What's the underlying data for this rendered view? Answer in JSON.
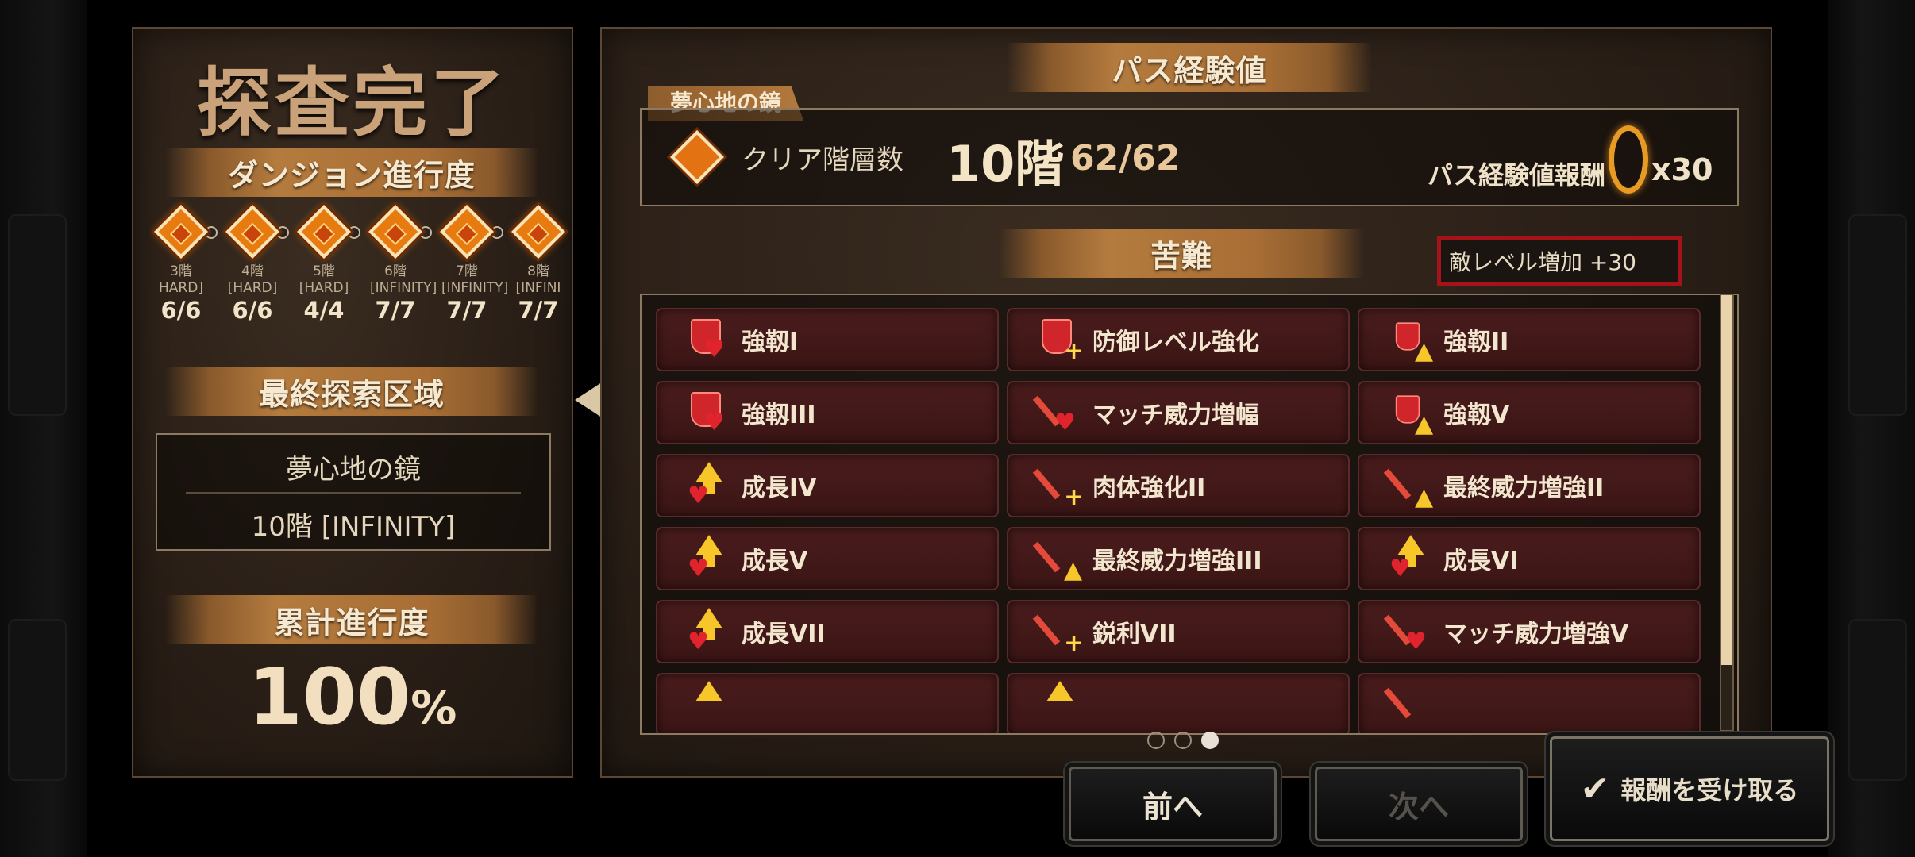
{
  "title": "探査完了",
  "dungeon_progress": {
    "heading": "ダンジョン進行度",
    "floors": [
      {
        "floor": "3階",
        "mode": "HARD]",
        "count": "6/6"
      },
      {
        "floor": "4階",
        "mode": "[HARD]",
        "count": "6/6"
      },
      {
        "floor": "5階",
        "mode": "[HARD]",
        "count": "4/4"
      },
      {
        "floor": "6階",
        "mode": "[INFINITY]",
        "count": "7/7"
      },
      {
        "floor": "7階",
        "mode": "[INFINITY]",
        "count": "7/7"
      },
      {
        "floor": "8階",
        "mode": "[INFINI",
        "count": "7/7"
      }
    ]
  },
  "final_area": {
    "heading": "最終探索区域",
    "name": "夢心地の鏡",
    "floor": "10階 [INFINITY]"
  },
  "total_progress": {
    "heading": "累計進行度",
    "value": "100",
    "unit": "%"
  },
  "pass_exp": {
    "heading": "パス経験値",
    "tag": "夢心地の鏡",
    "clear_label": "クリア階層数",
    "clear_floor": "10階",
    "clear_count": "62/62",
    "reward_label": "パス経験値報酬",
    "reward_mult": "x30"
  },
  "hardship": {
    "heading": "苦難",
    "enemy_level": "敵レベル増加 +30",
    "items": [
      {
        "label": "強靱I",
        "icon": "shield-heart-icon"
      },
      {
        "label": "防御レベル強化",
        "icon": "shield-plus-icon"
      },
      {
        "label": "強靱II",
        "icon": "shield-up-icon"
      },
      {
        "label": "強靱III",
        "icon": "shield-heart-icon"
      },
      {
        "label": "マッチ威力増幅",
        "icon": "sword-heart-icon"
      },
      {
        "label": "強靱V",
        "icon": "shield-up-icon"
      },
      {
        "label": "成長IV",
        "icon": "up-heart-icon"
      },
      {
        "label": "肉体強化II",
        "icon": "sword-plus-icon"
      },
      {
        "label": "最終威力増強II",
        "icon": "sword-up-icon"
      },
      {
        "label": "成長V",
        "icon": "up-heart-icon"
      },
      {
        "label": "最終威力増強III",
        "icon": "sword-up-icon"
      },
      {
        "label": "成長VI",
        "icon": "up-heart-icon"
      },
      {
        "label": "成長VII",
        "icon": "up-heart-icon"
      },
      {
        "label": "鋭利VII",
        "icon": "sword-plus-icon"
      },
      {
        "label": "マッチ威力増強V",
        "icon": "sword-heart-icon"
      }
    ]
  },
  "pager": {
    "pages": 3,
    "current": 3
  },
  "buttons": {
    "prev": "前へ",
    "next": "次へ",
    "claim": "報酬を受け取る"
  }
}
